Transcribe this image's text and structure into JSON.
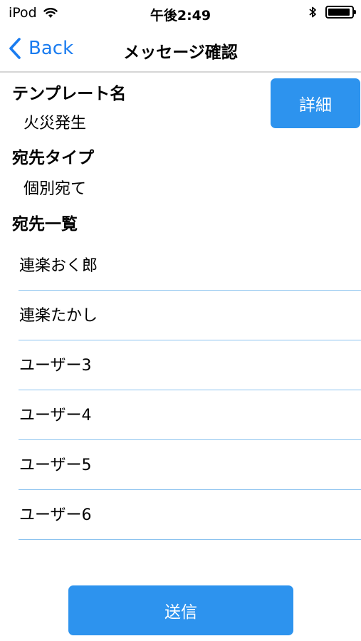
{
  "status_bar": {
    "carrier": "iPod",
    "time": "午後2:49",
    "wifi_icon": "wifi-icon",
    "bluetooth_icon": "bluetooth-icon",
    "battery_icon": "battery-icon"
  },
  "nav": {
    "back_label": "Back",
    "title": "メッセージ確認"
  },
  "template": {
    "label": "テンプレート名",
    "value": "火災発生",
    "detail_button": "詳細"
  },
  "destination_type": {
    "label": "宛先タイプ",
    "value": "個別宛て"
  },
  "recipients": {
    "label": "宛先一覧",
    "items": [
      {
        "name": "連楽おく郎"
      },
      {
        "name": "連楽たかし"
      },
      {
        "name": "ユーザー3"
      },
      {
        "name": "ユーザー4"
      },
      {
        "name": "ユーザー5"
      },
      {
        "name": "ユーザー6"
      }
    ]
  },
  "footer": {
    "send_button": "送信"
  },
  "colors": {
    "accent": "#1a7cf0",
    "button": "#2d93ee",
    "divider": "#8cc3ef"
  }
}
